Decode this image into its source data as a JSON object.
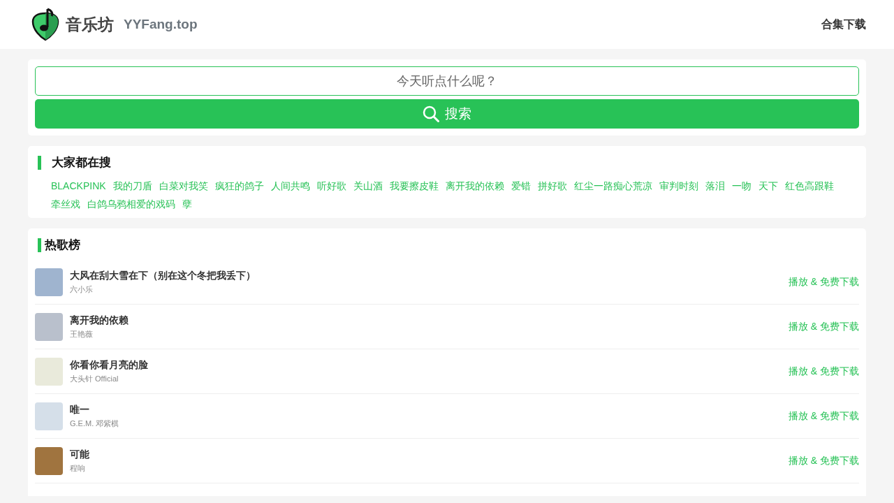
{
  "header": {
    "brand": "音乐坊",
    "domain": "YYFang.top",
    "nav_link": "合集下载"
  },
  "search": {
    "placeholder": "今天听点什么呢？",
    "button": "搜索"
  },
  "popular_searches": {
    "title": "大家都在搜",
    "tags": [
      "BLACKPINK",
      "我的刀盾",
      "白菜对我笑",
      "疯狂的鸽子",
      "人间共鸣",
      "听好歌",
      "关山酒",
      "我要擦皮鞋",
      "离开我的依赖",
      "爱错",
      "拼好歌",
      "红尘一路痴心荒凉",
      "审判时刻",
      "落泪",
      "一吻",
      "天下",
      "红色高跟鞋",
      "牵丝戏",
      "白鸽乌鸦相爱的戏码",
      "孽"
    ]
  },
  "chart": {
    "title": "热歌榜",
    "songs": [
      {
        "title": "大风在刮大雪在下（别在这个冬把我丢下）",
        "artist": "六小乐",
        "action": "播放 & 免费下载",
        "color": "#9fb4cf"
      },
      {
        "title": "离开我的依赖",
        "artist": "王艳薇",
        "action": "播放 & 免费下载",
        "color": "#b9c0cc"
      },
      {
        "title": "你看你看月亮的脸",
        "artist": "大头针 Official",
        "action": "播放 & 免费下载",
        "color": "#e9eadb"
      },
      {
        "title": "唯一",
        "artist": "G.E.M. 邓紫棋",
        "action": "播放 & 免费下载",
        "color": "#d5dfe9"
      },
      {
        "title": "可能",
        "artist": "程响",
        "action": "播放 & 免费下载",
        "color": "#a0743f"
      }
    ]
  }
}
